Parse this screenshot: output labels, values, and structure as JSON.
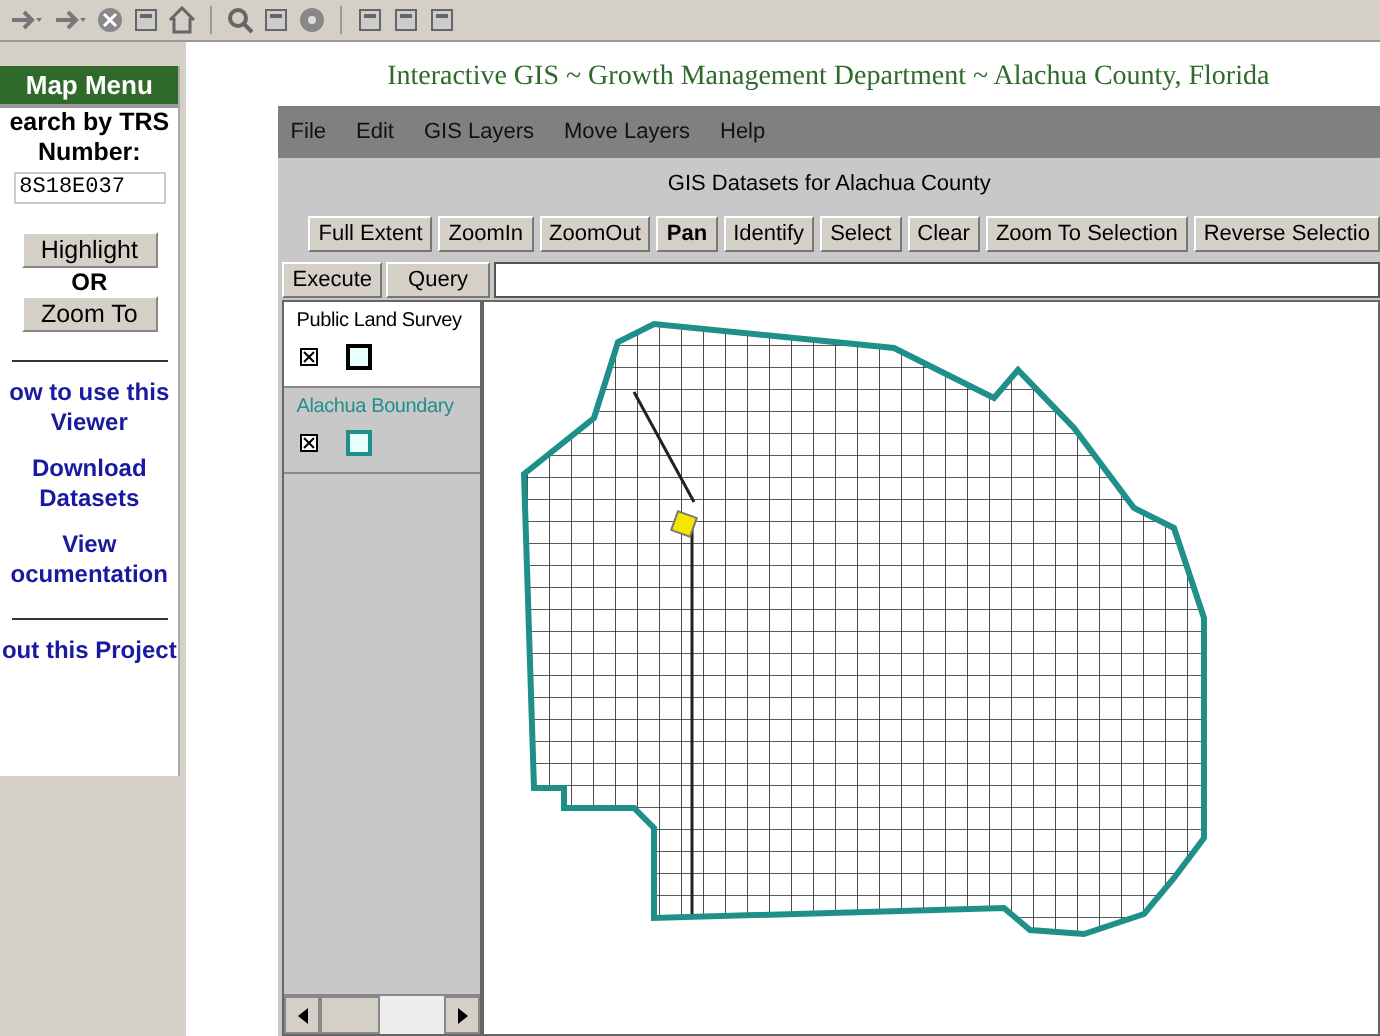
{
  "sidebar": {
    "title": "Map Menu",
    "search_label": "earch by TRS",
    "search_label_2": "Number:",
    "search_value": "8S18E037",
    "buttons": [
      "Highlight",
      "Zoom To"
    ],
    "or_label": "OR",
    "links": [
      {
        "lines": [
          "ow to use this",
          "Viewer"
        ]
      },
      {
        "lines": [
          "Download",
          "Datasets"
        ]
      },
      {
        "lines": [
          "View",
          "ocumentation"
        ]
      },
      {
        "lines": [
          "out this Project"
        ]
      }
    ]
  },
  "page_title": "Interactive GIS ~ Growth Management Department ~ Alachua County, Florida",
  "app": {
    "menu": [
      "File",
      "Edit",
      "GIS Layers",
      "Move Layers",
      "Help"
    ],
    "subtitle": "GIS Datasets for Alachua County",
    "tools": [
      {
        "label": "Full Extent",
        "selected": false
      },
      {
        "label": "ZoomIn",
        "selected": false
      },
      {
        "label": "ZoomOut",
        "selected": false
      },
      {
        "label": "Pan",
        "selected": true
      },
      {
        "label": "Identify",
        "selected": false
      },
      {
        "label": "Select",
        "selected": false
      },
      {
        "label": "Clear",
        "selected": false
      },
      {
        "label": "Zoom To Selection",
        "selected": false
      },
      {
        "label": "Reverse Selectio",
        "selected": false
      }
    ],
    "tabs": [
      "Execute",
      "Query"
    ],
    "layers": [
      {
        "name": "Public Land Survey",
        "visible": true,
        "selected": false,
        "color": "#000000"
      },
      {
        "name": "Alachua Boundary",
        "visible": true,
        "selected": true,
        "color": "#1f8f8a"
      }
    ]
  }
}
